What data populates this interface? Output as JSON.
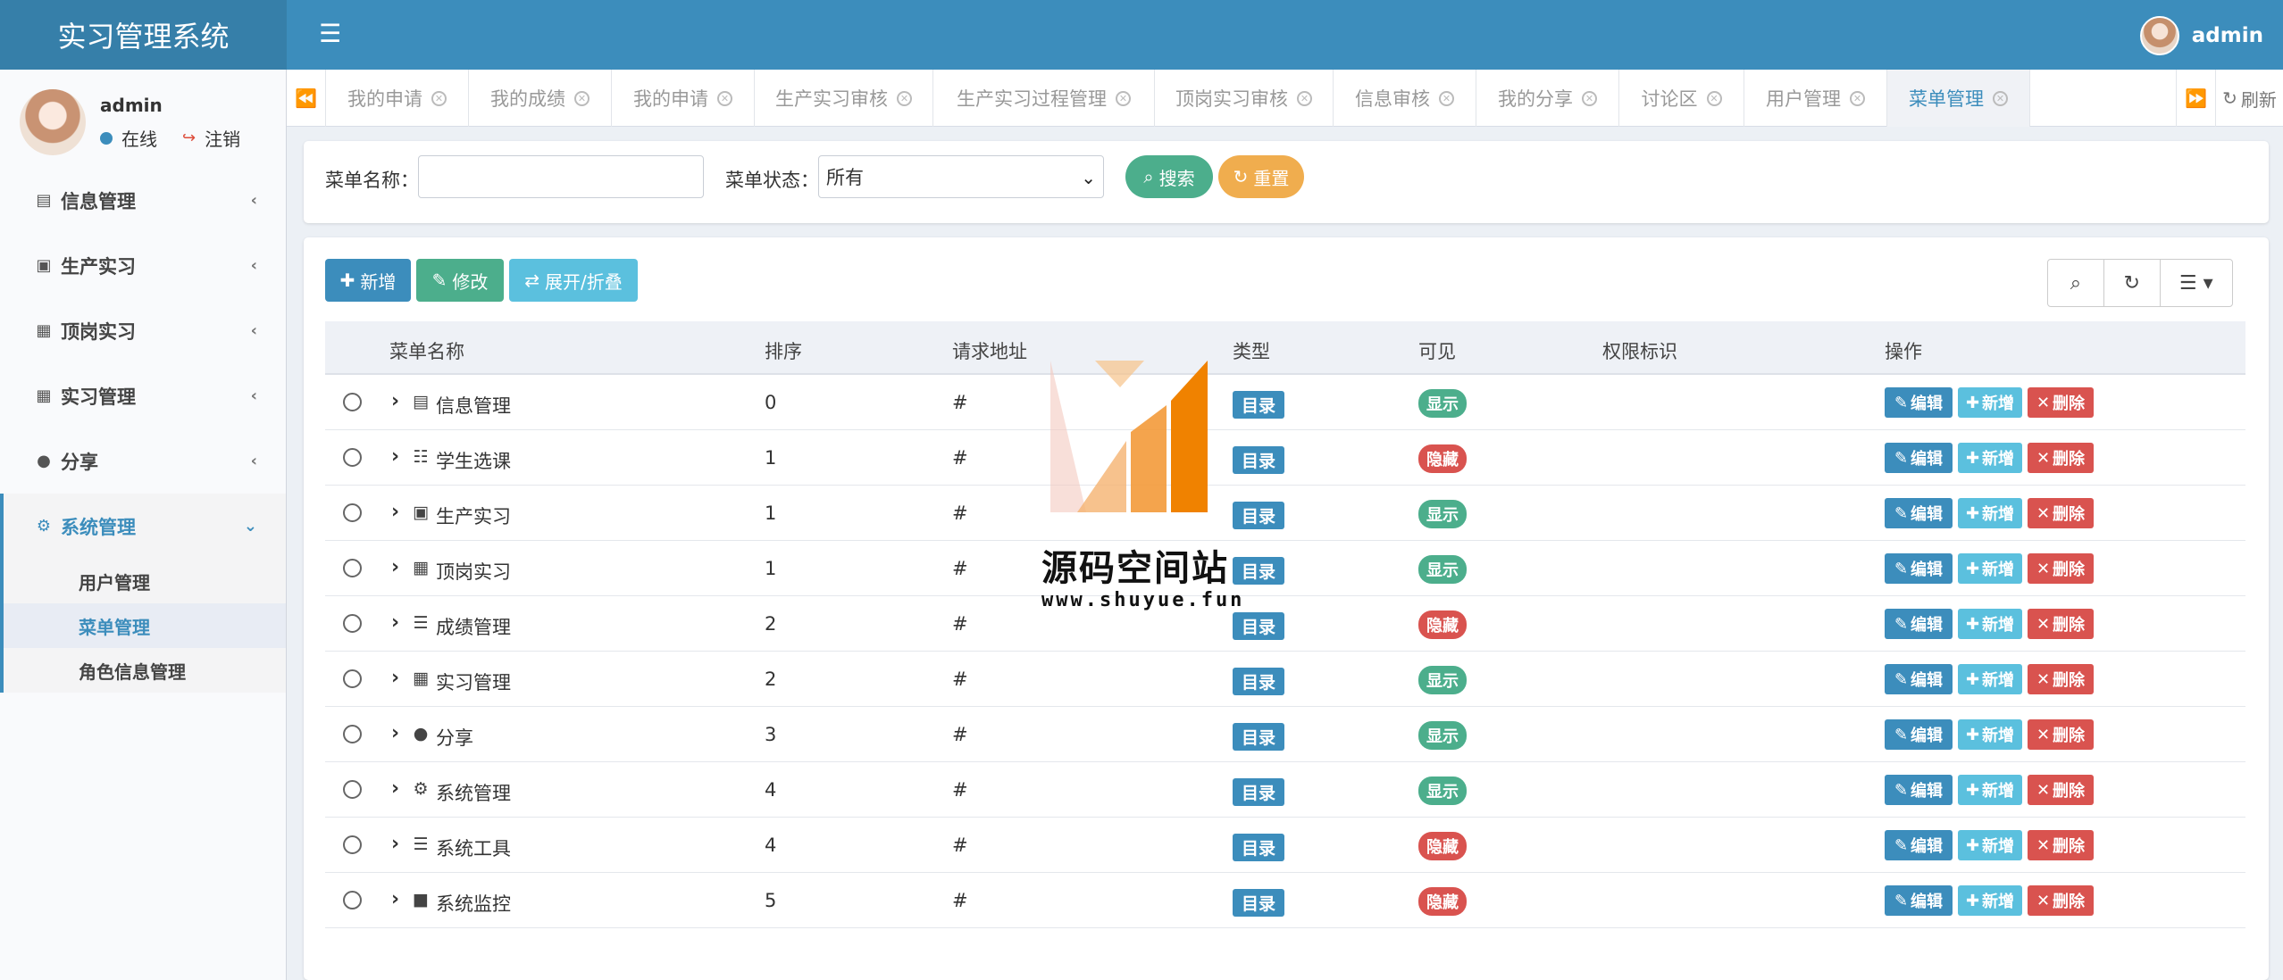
{
  "app": {
    "title": "实习管理系统"
  },
  "topbar": {
    "user": "admin"
  },
  "user_panel": {
    "name": "admin",
    "status": "在线",
    "logout": "注销"
  },
  "sidebar": {
    "items": [
      {
        "label": "信息管理",
        "icon": "contact-card-icon"
      },
      {
        "label": "生产实习",
        "icon": "person-badge-icon"
      },
      {
        "label": "顶岗实习",
        "icon": "id-card-icon"
      },
      {
        "label": "实习管理",
        "icon": "id-card-icon"
      },
      {
        "label": "分享",
        "icon": "comment-icon"
      },
      {
        "label": "系统管理",
        "icon": "gear-icon",
        "expanded": true
      }
    ],
    "subitems": [
      {
        "label": "用户管理"
      },
      {
        "label": "菜单管理",
        "active": true
      },
      {
        "label": "角色信息管理"
      }
    ]
  },
  "tabs": [
    {
      "label": "我的申请"
    },
    {
      "label": "我的成绩"
    },
    {
      "label": "我的申请"
    },
    {
      "label": "生产实习审核"
    },
    {
      "label": "生产实习过程管理"
    },
    {
      "label": "顶岗实习审核"
    },
    {
      "label": "信息审核"
    },
    {
      "label": "我的分享"
    },
    {
      "label": "讨论区"
    },
    {
      "label": "用户管理"
    },
    {
      "label": "菜单管理",
      "active": true
    }
  ],
  "tabs_refresh": "刷新",
  "search": {
    "name_label": "菜单名称：",
    "name_value": "",
    "status_label": "菜单状态：",
    "status_value": "所有",
    "search_button": "搜索",
    "reset_button": "重置"
  },
  "toolbar": {
    "add": "新增",
    "edit": "修改",
    "toggle": "展开/折叠"
  },
  "table": {
    "headers": [
      "菜单名称",
      "排序",
      "请求地址",
      "类型",
      "可见",
      "权限标识",
      "操作"
    ],
    "rows": [
      {
        "name": "信息管理",
        "icon": "contact-card-icon",
        "order": "0",
        "url": "#",
        "type": "目录",
        "visible": "显示",
        "perm": ""
      },
      {
        "name": "学生选课",
        "icon": "bar-chart-icon",
        "order": "1",
        "url": "#",
        "type": "目录",
        "visible": "隐藏",
        "perm": ""
      },
      {
        "name": "生产实习",
        "icon": "person-badge-icon",
        "order": "1",
        "url": "#",
        "type": "目录",
        "visible": "显示",
        "perm": ""
      },
      {
        "name": "顶岗实习",
        "icon": "id-card-icon",
        "order": "1",
        "url": "#",
        "type": "目录",
        "visible": "显示",
        "perm": ""
      },
      {
        "name": "成绩管理",
        "icon": "list-icon",
        "order": "2",
        "url": "#",
        "type": "目录",
        "visible": "隐藏",
        "perm": ""
      },
      {
        "name": "实习管理",
        "icon": "id-card-icon",
        "order": "2",
        "url": "#",
        "type": "目录",
        "visible": "显示",
        "perm": ""
      },
      {
        "name": "分享",
        "icon": "comment-icon",
        "order": "3",
        "url": "#",
        "type": "目录",
        "visible": "显示",
        "perm": ""
      },
      {
        "name": "系统管理",
        "icon": "gear-icon",
        "order": "4",
        "url": "#",
        "type": "目录",
        "visible": "显示",
        "perm": ""
      },
      {
        "name": "系统工具",
        "icon": "list-icon",
        "order": "4",
        "url": "#",
        "type": "目录",
        "visible": "隐藏",
        "perm": ""
      },
      {
        "name": "系统监控",
        "icon": "video-camera-icon",
        "order": "5",
        "url": "#",
        "type": "目录",
        "visible": "隐藏",
        "perm": ""
      }
    ],
    "actions": {
      "edit": "编辑",
      "add": "新增",
      "delete": "删除"
    }
  },
  "watermark": {
    "title": "源码空间站",
    "url": "www.shuyue.fun"
  },
  "colors": {
    "primary": "#3c8dbc",
    "success": "#4cae8c",
    "info": "#5bc0de",
    "warning": "#f0ad4e",
    "danger": "#d9534f"
  }
}
